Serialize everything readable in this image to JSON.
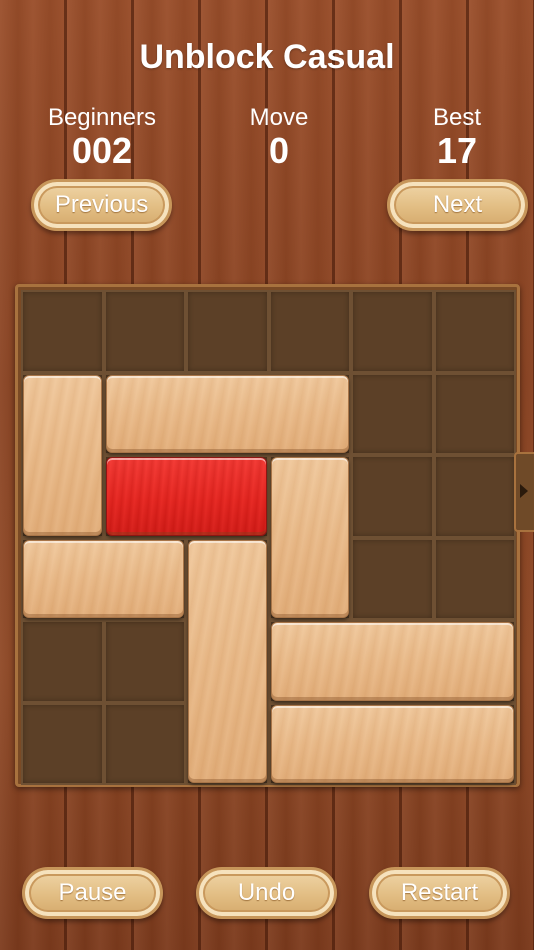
{
  "header": {
    "title": "Unblock Casual"
  },
  "stats": {
    "level": {
      "label": "Beginners",
      "value": "002"
    },
    "moves": {
      "label": "Move",
      "value": "0"
    },
    "best": {
      "label": "Best",
      "value": "17"
    }
  },
  "nav": {
    "previous_label": "Previous",
    "next_label": "Next"
  },
  "footer": {
    "pause_label": "Pause",
    "undo_label": "Undo",
    "restart_label": "Restart"
  },
  "board": {
    "grid_size": 6,
    "exit_row": 2,
    "exit_side": "right",
    "blocks": [
      {
        "id": "vertical-block-1",
        "row": 1,
        "col": 0,
        "length": 2,
        "orientation": "vertical",
        "target": false
      },
      {
        "id": "horizontal-block-1",
        "row": 1,
        "col": 1,
        "length": 3,
        "orientation": "horizontal",
        "target": false
      },
      {
        "id": "target-block",
        "row": 2,
        "col": 1,
        "length": 2,
        "orientation": "horizontal",
        "target": true
      },
      {
        "id": "vertical-block-2",
        "row": 2,
        "col": 3,
        "length": 2,
        "orientation": "vertical",
        "target": false
      },
      {
        "id": "horizontal-block-2",
        "row": 3,
        "col": 0,
        "length": 2,
        "orientation": "horizontal",
        "target": false
      },
      {
        "id": "vertical-block-3",
        "row": 3,
        "col": 2,
        "length": 3,
        "orientation": "vertical",
        "target": false
      },
      {
        "id": "horizontal-block-3",
        "row": 4,
        "col": 3,
        "length": 3,
        "orientation": "horizontal",
        "target": false
      },
      {
        "id": "horizontal-block-4",
        "row": 5,
        "col": 3,
        "length": 3,
        "orientation": "horizontal",
        "target": false
      }
    ]
  },
  "colors": {
    "wood_background": "#8f4825",
    "block_wood": "#e9b987",
    "target_block": "#e52620",
    "board_cell": "#5c4027"
  },
  "icons": {
    "exit": "exit-arrow-icon"
  }
}
